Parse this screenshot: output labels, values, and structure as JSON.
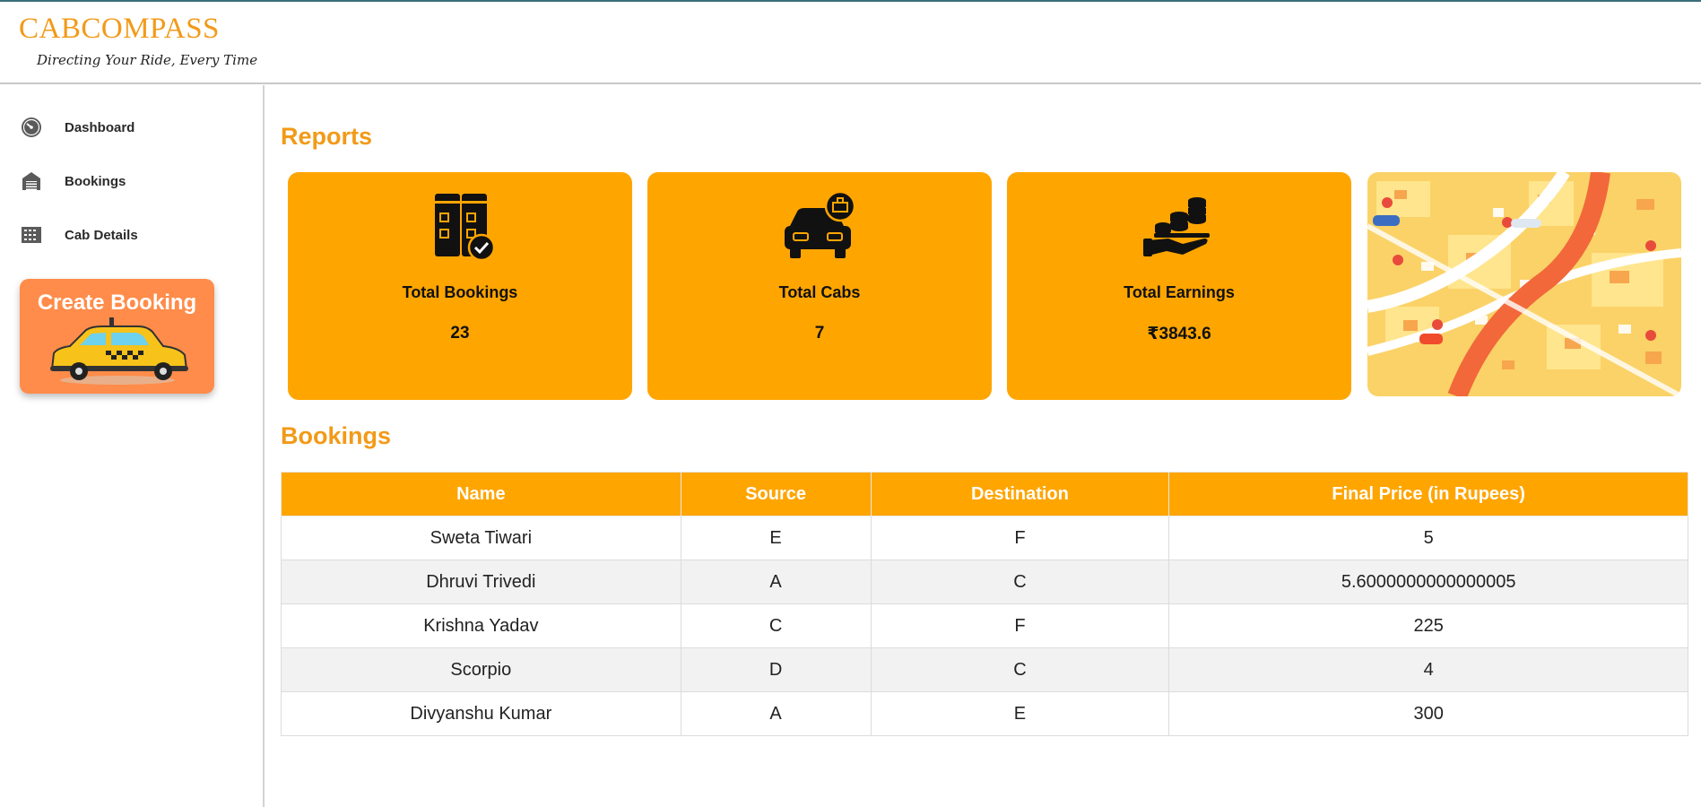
{
  "brand": {
    "name": "CABCOMPASS",
    "tagline": "Directing Your Ride, Every Time"
  },
  "sidebar": {
    "items": [
      {
        "label": "Dashboard",
        "icon": "dashboard-gauge-icon"
      },
      {
        "label": "Bookings",
        "icon": "garage-icon"
      },
      {
        "label": "Cab Details",
        "icon": "grid-table-icon"
      }
    ],
    "create_booking": {
      "label": "Create Booking",
      "icon": "taxi-car-icon"
    }
  },
  "reports": {
    "title": "Reports",
    "cards": [
      {
        "label": "Total Bookings",
        "value": "23",
        "icon": "booking-binders-icon"
      },
      {
        "label": "Total Cabs",
        "value": "7",
        "icon": "cab-icon"
      },
      {
        "label": "Total Earnings",
        "value": "₹3843.6",
        "icon": "coins-hand-icon"
      }
    ],
    "map_icon": "city-map-illustration"
  },
  "bookings": {
    "title": "Bookings",
    "columns": [
      "Name",
      "Source",
      "Destination",
      "Final Price (in Rupees)"
    ],
    "rows": [
      [
        "Sweta Tiwari",
        "E",
        "F",
        "5"
      ],
      [
        "Dhruvi Trivedi",
        "A",
        "C",
        "5.6000000000000005"
      ],
      [
        "Krishna Yadav",
        "C",
        "F",
        "225"
      ],
      [
        "Scorpio",
        "D",
        "C",
        "4"
      ],
      [
        "Divyanshu Kumar",
        "A",
        "E",
        "300"
      ]
    ]
  },
  "colors": {
    "accent": "#ffa500",
    "brand": "#f29a18",
    "create_card": "#ff8c4a"
  }
}
